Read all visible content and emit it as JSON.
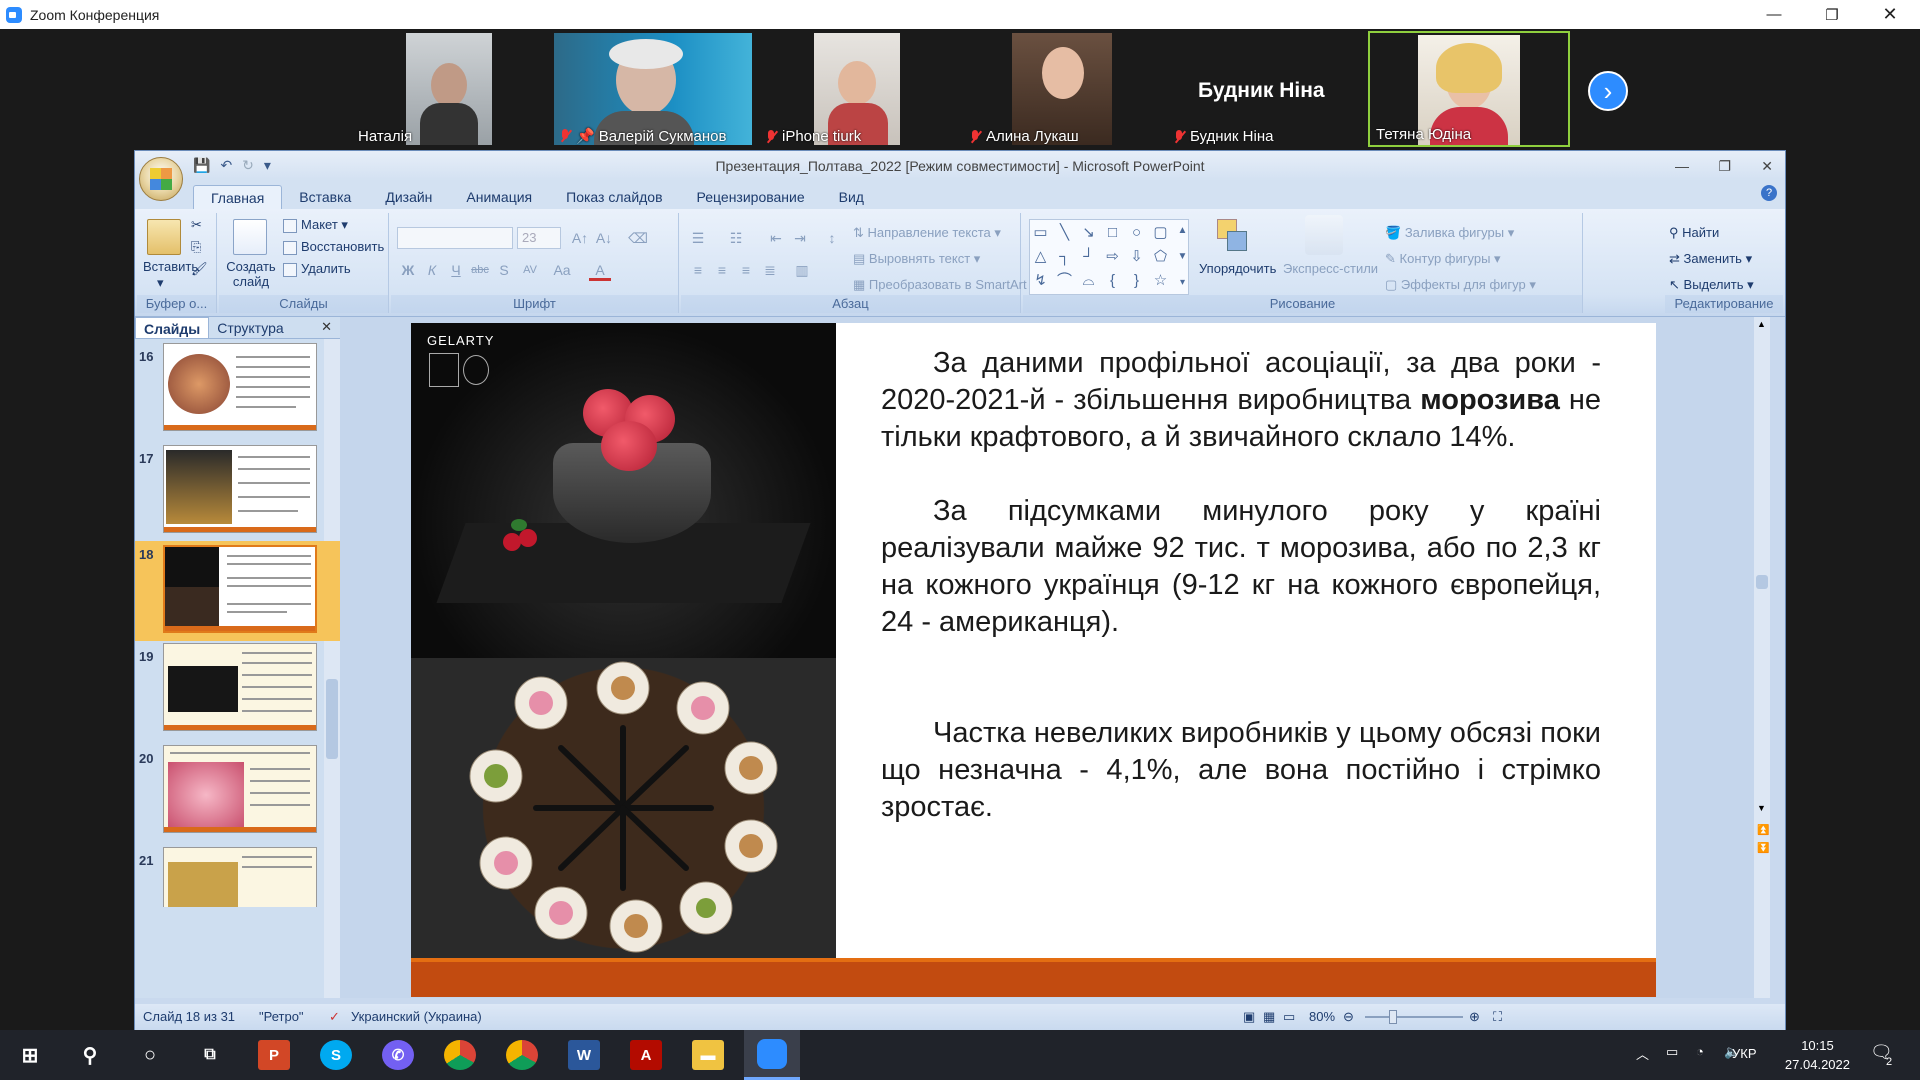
{
  "zoom": {
    "window_title": "Zoom Конференция",
    "participants": [
      {
        "name": "Наталія",
        "muted": false
      },
      {
        "name": "Валерій Сукманов",
        "muted": true
      },
      {
        "name": "iPhone tiurk",
        "muted": true
      },
      {
        "name": "Алина Лукаш",
        "muted": true
      },
      {
        "name": "Будник Ніна",
        "muted": true,
        "big_name": "Будник Ніна"
      },
      {
        "name": "Тетяна Юдіна",
        "muted": false
      }
    ]
  },
  "ppt": {
    "window_title": "Презентация_Полтава_2022 [Режим совместимости] - Microsoft PowerPoint",
    "tabs": [
      "Главная",
      "Вставка",
      "Дизайн",
      "Анимация",
      "Показ слайдов",
      "Рецензирование",
      "Вид"
    ],
    "active_tab": "Главная",
    "ribbon": {
      "clipboard": {
        "paste": "Вставить",
        "label": "Буфер о..."
      },
      "slides": {
        "new_slide": "Создать слайд",
        "layout": "Макет",
        "reset": "Восстановить",
        "delete": "Удалить",
        "label": "Слайды"
      },
      "font": {
        "size": "23",
        "label": "Шрифт"
      },
      "paragraph": {
        "text_direction": "Направление текста",
        "align_text": "Выровнять текст",
        "smartart": "Преобразовать в SmartArt",
        "label": "Абзац"
      },
      "drawing": {
        "arrange": "Упорядочить",
        "quick_styles": "Экспресс-стили",
        "fill": "Заливка фигуры",
        "outline": "Контур фигуры",
        "effects": "Эффекты для фигур",
        "label": "Рисование"
      },
      "editing": {
        "find": "Найти",
        "replace": "Заменить",
        "select": "Выделить",
        "label": "Редактирование"
      }
    },
    "pane_tabs": {
      "slides": "Слайды",
      "outline": "Структура"
    },
    "thumbnails": [
      {
        "num": "16"
      },
      {
        "num": "17"
      },
      {
        "num": "18",
        "selected": true
      },
      {
        "num": "19"
      },
      {
        "num": "20"
      },
      {
        "num": "21"
      }
    ],
    "slide": {
      "logo": "GELARTY",
      "p1_before": "За даними профільної асоціації, за два роки - 2020-2021-й - збільшення виробництва ",
      "p1_bold": "морозива",
      "p1_after": " не тільки крафтового, а й звичайного склало 14%.",
      "p2": "За підсумками минулого року у країні реалізували майже 92 тис. т морозива, або по 2,3 кг на кожного українця (9-12 кг на кожного європейця, 24 - американця).",
      "p3": "Частка невеликих виробників у цьому обсязі поки що незначна - 4,1%, але вона постійно і стрімко зростає."
    },
    "status": {
      "slide_info": "Слайд 18 из 31",
      "theme": "\"Ретро\"",
      "language": "Украинский (Украина)",
      "zoom": "80%"
    }
  },
  "taskbar": {
    "lang": "УКР",
    "time": "10:15",
    "date": "27.04.2022",
    "notif": "2"
  }
}
